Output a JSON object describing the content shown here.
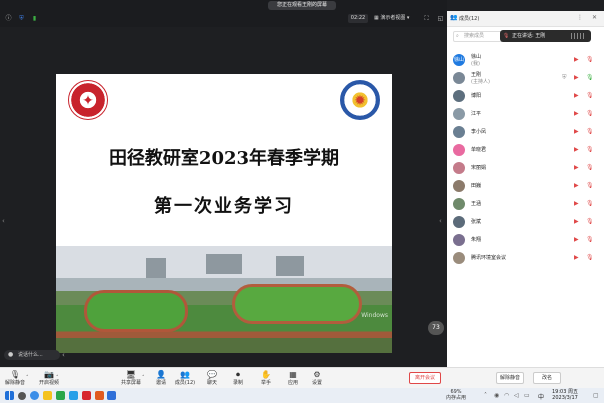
{
  "window": {
    "viewing_banner": "您正在观看王刚的屏幕",
    "clock": "02:22",
    "view_mode": "演示者视图",
    "participants_tab": "成员(12)"
  },
  "speaking": {
    "label": "正在讲话: 王刚"
  },
  "slide": {
    "title_line1": "田径教研室2023年春季学期",
    "title_line2": "第一次业务学习",
    "watermark": "Windows",
    "page_badge": "73"
  },
  "speaker_bar": {
    "label": "说话什么..."
  },
  "panel": {
    "title": "成员(12)",
    "search_placeholder": "搜索成员",
    "participants": [
      {
        "name": "徐山",
        "role": "(我)",
        "avatar_text": "徐山",
        "avatar_color": "#1f7ae0"
      },
      {
        "name": "王刚",
        "role": "(主持人)",
        "avatar_text": "",
        "avatar_color": "#7a8896",
        "mic_on": true
      },
      {
        "name": "博阳",
        "role": "",
        "avatar_text": "",
        "avatar_color": "#5d6f7e"
      },
      {
        "name": "江平",
        "role": "",
        "avatar_text": "",
        "avatar_color": "#8a9aa6"
      },
      {
        "name": "李小凤",
        "role": "",
        "avatar_text": "",
        "avatar_color": "#6a7f92"
      },
      {
        "name": "单晓君",
        "role": "",
        "avatar_text": "",
        "avatar_color": "#e96aa0"
      },
      {
        "name": "宋丽娟",
        "role": "",
        "avatar_text": "",
        "avatar_color": "#c47b8a"
      },
      {
        "name": "田巍",
        "role": "",
        "avatar_text": "",
        "avatar_color": "#8c7b6b"
      },
      {
        "name": "王涵",
        "role": "",
        "avatar_text": "",
        "avatar_color": "#6f8a6b"
      },
      {
        "name": "张斌",
        "role": "",
        "avatar_text": "",
        "avatar_color": "#5c6b7a"
      },
      {
        "name": "朱翔",
        "role": "",
        "avatar_text": "",
        "avatar_color": "#7a6f8f"
      },
      {
        "name": "腾讯环境室会议",
        "role": "",
        "avatar_text": "",
        "avatar_color": "#9a8c7c"
      }
    ]
  },
  "toolbar": {
    "items": [
      {
        "icon": "mic-icon",
        "glyph": "🎙",
        "label": "解除静音"
      },
      {
        "icon": "video-icon",
        "glyph": "📷",
        "label": "开启视频"
      },
      {
        "icon": "share-icon",
        "glyph": "🖥",
        "label": "共享屏幕"
      },
      {
        "icon": "invite-icon",
        "glyph": "👤",
        "label": "邀请"
      },
      {
        "icon": "members-icon",
        "glyph": "👥",
        "label": "成员(12)"
      },
      {
        "icon": "chat-icon",
        "glyph": "💬",
        "label": "聊天"
      },
      {
        "icon": "record-icon",
        "glyph": "⏺",
        "label": "录制"
      },
      {
        "icon": "raise-hand-icon",
        "glyph": "✋",
        "label": "举手"
      },
      {
        "icon": "apps-icon",
        "glyph": "▦",
        "label": "应用"
      },
      {
        "icon": "settings-icon",
        "glyph": "⚙",
        "label": "设置"
      }
    ],
    "leave_label": "离开会议",
    "unmute_all_label": "解除静音",
    "rename_label": "改名"
  },
  "taskbar": {
    "mem_percent": "69%",
    "mem_label": "内存占用",
    "time": "19:03 周五",
    "date": "2023/3/17",
    "ime": "中"
  }
}
